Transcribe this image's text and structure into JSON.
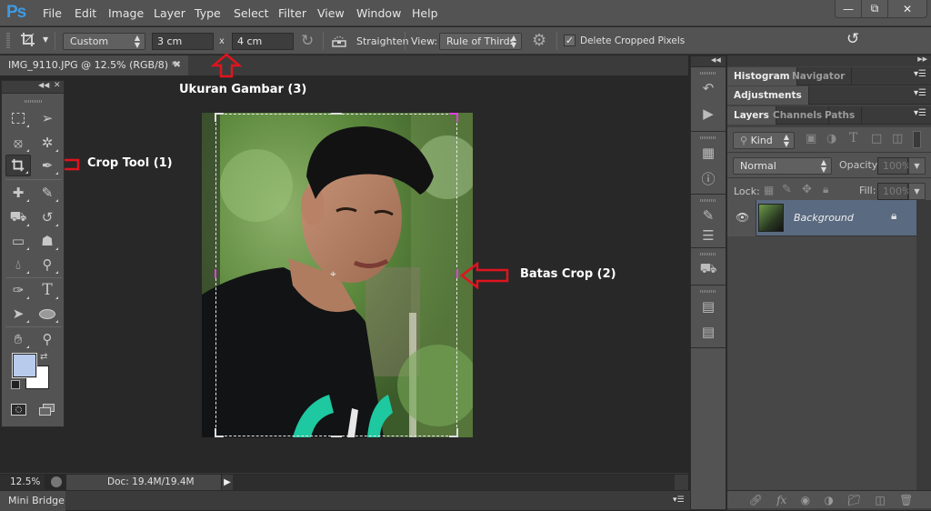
{
  "app": {
    "logo": "Ps",
    "name": "Adobe Photoshop"
  },
  "menu": [
    "File",
    "Edit",
    "Image",
    "Layer",
    "Type",
    "Select",
    "Filter",
    "View",
    "Window",
    "Help"
  ],
  "window_controls": {
    "minimize": "minimize-icon",
    "restore": "restore-icon",
    "close": "close-icon"
  },
  "options_bar": {
    "tool_icon": "crop-icon",
    "ratio_preset": "Custom",
    "width_value": "3 cm",
    "times_symbol": "x",
    "height_value": "4 cm",
    "clear_icon": "rotate-icon",
    "straighten_label": "Straighten",
    "view_label": "View:",
    "view_value": "Rule of Thirds",
    "settings_icon": "gear-icon",
    "delete_cropped_checked": true,
    "delete_cropped_label": "Delete Cropped Pixels",
    "reset_icon": "reset-icon"
  },
  "document": {
    "tab_title": "IMG_9110.JPG @ 12.5% (RGB/8) *",
    "zoom": "12.5%",
    "doc_info": "Doc: 19.4M/19.4M"
  },
  "annotations": [
    {
      "text": "Ukuran Gambar  (3)"
    },
    {
      "text": "Crop Tool  (1)"
    },
    {
      "text": "Batas Crop  (2)"
    }
  ],
  "tools": [
    "rectangular-marquee",
    "move",
    "lasso",
    "magic-wand",
    "crop",
    "eyedropper",
    "spot-healing",
    "brush",
    "clone-stamp",
    "history-brush",
    "eraser",
    "paint-bucket",
    "blur",
    "dodge",
    "pen",
    "type",
    "path-selection",
    "ellipse",
    "hand",
    "zoom"
  ],
  "colors": {
    "foreground": "#b8cbec",
    "background": "#ffffff",
    "accent": "#3d9ae4",
    "annotation_arrow": "#e0141e",
    "selected_layer": "#5a6a80"
  },
  "mini_bridge": {
    "label": "Mini Bridge"
  },
  "panels": {
    "group1": {
      "tabs": [
        "Histogram",
        "Navigator"
      ],
      "active": 0
    },
    "group2": {
      "tabs": [
        "Adjustments"
      ],
      "active": 0
    },
    "group3": {
      "tabs": [
        "Layers",
        "Channels",
        "Paths"
      ],
      "active": 0
    },
    "layers": {
      "filter_kind": "Kind",
      "blend_mode": "Normal",
      "opacity_label": "Opacity:",
      "opacity_value": "100%",
      "lock_label": "Lock:",
      "fill_label": "Fill:",
      "fill_value": "100%",
      "items": [
        {
          "name": "Background",
          "visible": true,
          "locked": true
        }
      ]
    }
  }
}
